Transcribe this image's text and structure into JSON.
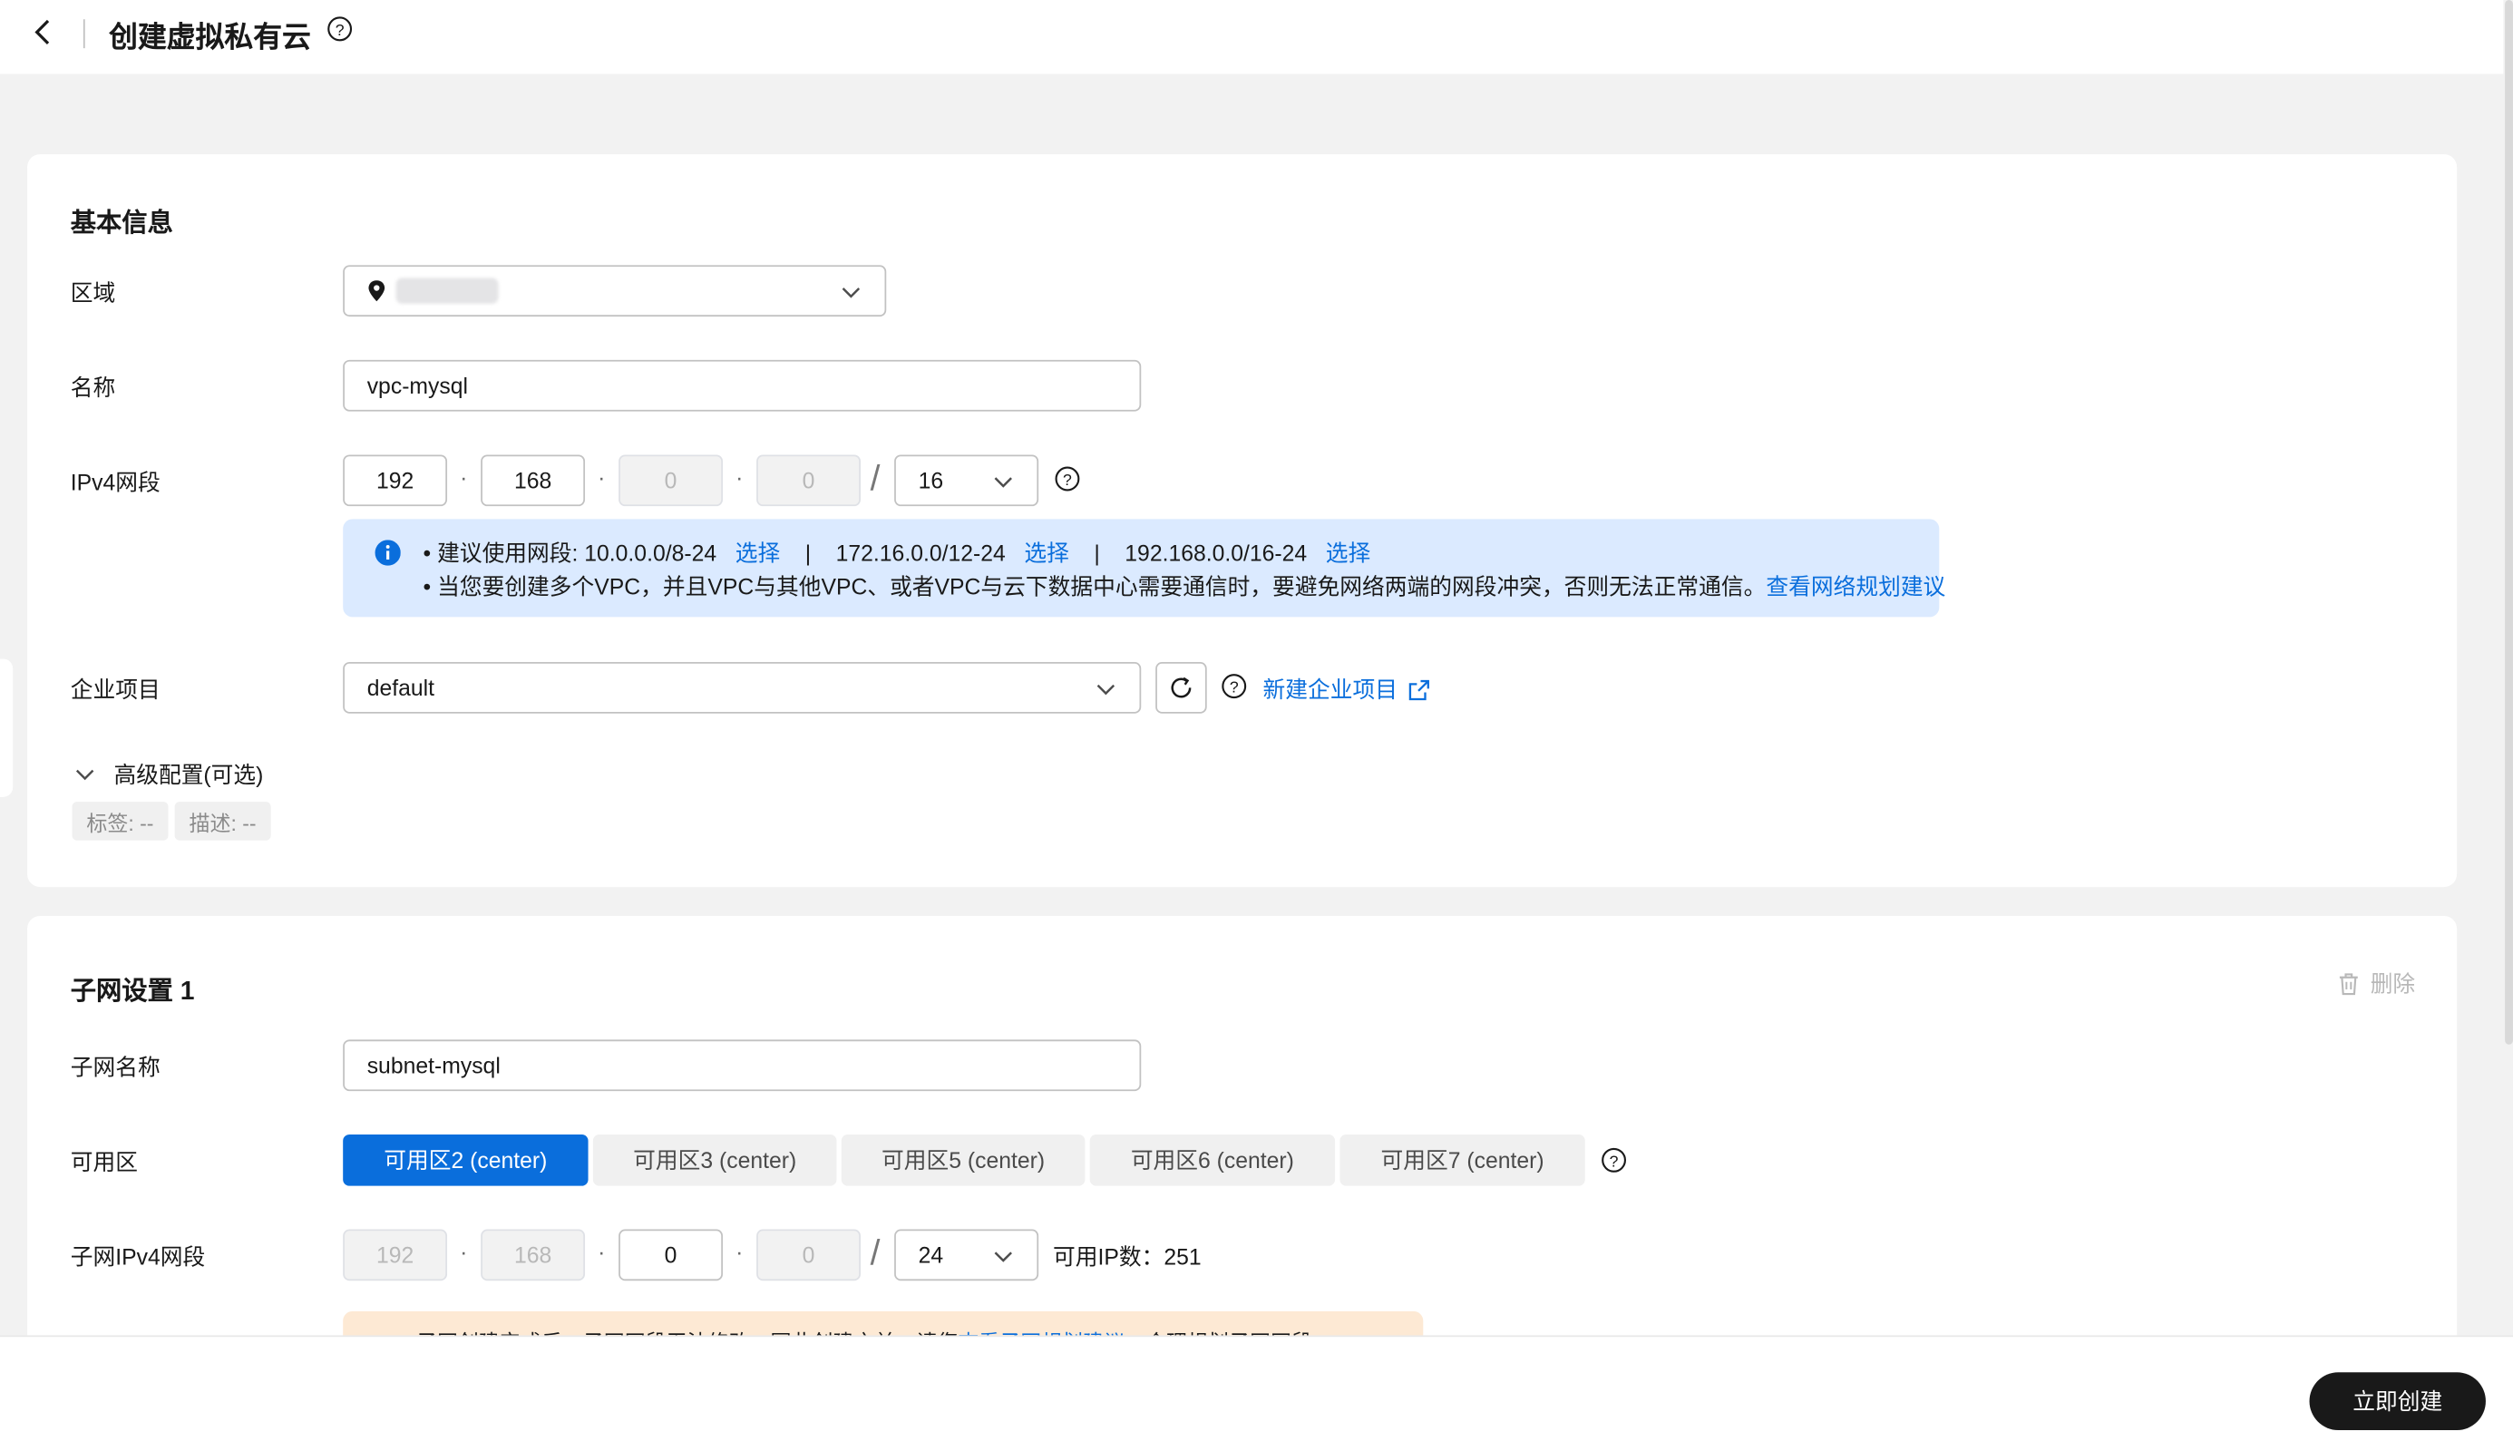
{
  "header": {
    "title": "创建虚拟私有云"
  },
  "basic": {
    "section_title": "基本信息",
    "region_label": "区域",
    "region_value": "",
    "name_label": "名称",
    "name_value": "vpc-mysql",
    "ipv4_label": "IPv4网段",
    "ipv4": {
      "octet1": "192",
      "octet2": "168",
      "octet3": "0",
      "octet4": "0",
      "mask": "16",
      "sep": "·",
      "slash": "/"
    },
    "info": {
      "line1_prefix": "建议使用网段: 10.0.0.0/8-24",
      "line1_link1": "选择",
      "line1_seg2": "172.16.0.0/12-24",
      "line1_link2": "选择",
      "line1_seg3": "192.168.0.0/16-24",
      "line1_link3": "选择",
      "separator": "|",
      "bullet": "•",
      "line2_text": "当您要创建多个VPC，并且VPC与其他VPC、或者VPC与云下数据中心需要通信时，要避免网络两端的网段冲突，否则无法正常通信。",
      "line2_link": "查看网络规划建议"
    },
    "enterprise_label": "企业项目",
    "enterprise_value": "default",
    "new_enterprise_link": "新建企业项目",
    "advanced_label": "高级配置(可选)",
    "tag_chip": "标签: --",
    "desc_chip": "描述: --"
  },
  "subnet": {
    "section_title": "子网设置 1",
    "delete_label": "删除",
    "name_label": "子网名称",
    "name_value": "subnet-mysql",
    "az_label": "可用区",
    "az_options": [
      "可用区2 (center)",
      "可用区3 (center)",
      "可用区5 (center)",
      "可用区6 (center)",
      "可用区7 (center)"
    ],
    "az_selected_index": 0,
    "ipv4_label": "子网IPv4网段",
    "ipv4": {
      "octet1": "192",
      "octet2": "168",
      "octet3": "0",
      "octet4": "0",
      "mask": "24"
    },
    "available_ip": "可用IP数：251",
    "warning_text": "子网创建完成后，子网网段无法修改，因此创建之前，请您",
    "warning_link": "查看子网规划建议",
    "warning_tail": "，合理规划子网网段。"
  },
  "footer": {
    "create_button": "立即创建"
  },
  "colors": {
    "accent": "#0a6edc",
    "info_bg": "#dbeaff",
    "warning_bg": "#fde9d4",
    "primary_button": "#191919"
  }
}
